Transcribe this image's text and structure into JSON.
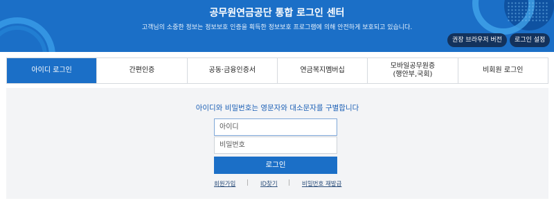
{
  "header": {
    "title": "공무원연금공단 통합 로그인 센터",
    "subtitle": "고객님의 소중한 정보는 정보보호 인증을 획득한 정보보호 프로그램에 의해 안전하게 보호되고 있습니다.",
    "browser_button": "권장 브라우저 버전",
    "settings_button": "로그인 설정",
    "brand_color": "#1b6fc7"
  },
  "tabs": [
    {
      "label": "아이디 로그인",
      "active": true
    },
    {
      "label": "간편인증",
      "active": false
    },
    {
      "label": "공동·금융인증서",
      "active": false
    },
    {
      "label": "연금복지멤버십",
      "active": false
    },
    {
      "label": "모바일공무원증\n(행안부,국회)",
      "active": false
    },
    {
      "label": "비회원 로그인",
      "active": false
    }
  ],
  "form": {
    "notice": "아이디와 비밀번호는 영문자와 대소문자를 구별합니다",
    "id_placeholder": "아이디",
    "pw_placeholder": "비밀번호",
    "login_button": "로그인",
    "links": {
      "join": "회원가입",
      "find_id": "ID찾기",
      "reset_pw": "비밀번호 재발급",
      "separator": "|"
    }
  }
}
